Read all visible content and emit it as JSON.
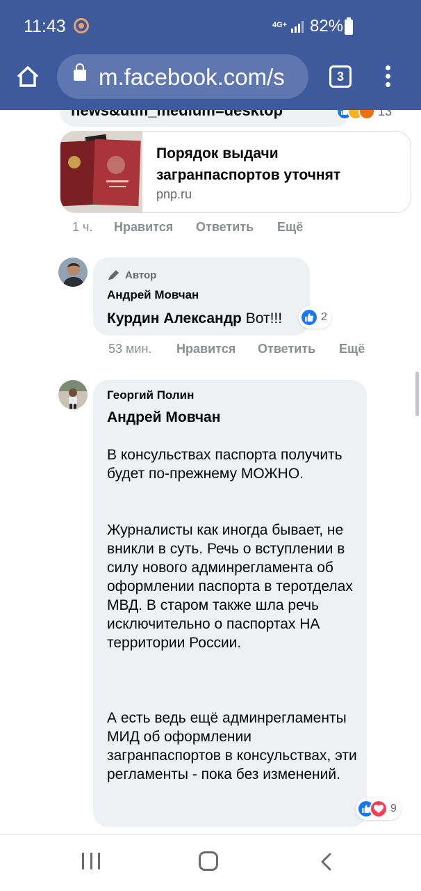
{
  "status_bar": {
    "time": "11:43",
    "network": "4G+",
    "battery": "82%"
  },
  "browser": {
    "url": "m.facebook.com/s",
    "tab_count": "3",
    "icons": [
      "home-icon",
      "lock-icon",
      "tabs-icon",
      "more-vert-icon"
    ]
  },
  "top_comment": {
    "partial_text": "news&utm_medium=desktop",
    "reaction_count": "13",
    "link_card": {
      "title": "Порядок выдачи загранпаспортов уточнят",
      "domain": "pnp.ru"
    },
    "meta": {
      "time": "1 ч.",
      "like": "Нравится",
      "reply": "Ответить",
      "more": "Ещё"
    }
  },
  "reply_1": {
    "badge": "Автор",
    "name": "Андрей Мовчан",
    "mention": "Курдин Александр",
    "text": "Вот!!!",
    "reaction_count": "2",
    "meta": {
      "time": "53 мин.",
      "like": "Нравится",
      "reply": "Ответить",
      "more": "Ещё"
    }
  },
  "reply_2": {
    "name": "Георгий Полин",
    "mention": "Андрей Мовчан",
    "paragraphs": [
      "В консульствах паспорта получить будет по-прежнему МОЖНО.",
      "Журналисты как иногда бывает, не вникли в суть. Речь о вступлении в силу нового админрегламента об оформлении паспорта в теротделах МВД. В старом также шла речь исключительно о паспортах НА территории России.",
      "А есть ведь ещё админрегламенты МИД об оформлении загранпаспортов в консульствах, эти регламенты - пока без изменений."
    ],
    "reaction_count": "9"
  },
  "colors": {
    "chrome": "#3d5a9c",
    "bubble": "#eef0f3",
    "like_blue": "#1877f2",
    "love_red": "#f33e58",
    "meta_gray": "#8a8d91"
  }
}
